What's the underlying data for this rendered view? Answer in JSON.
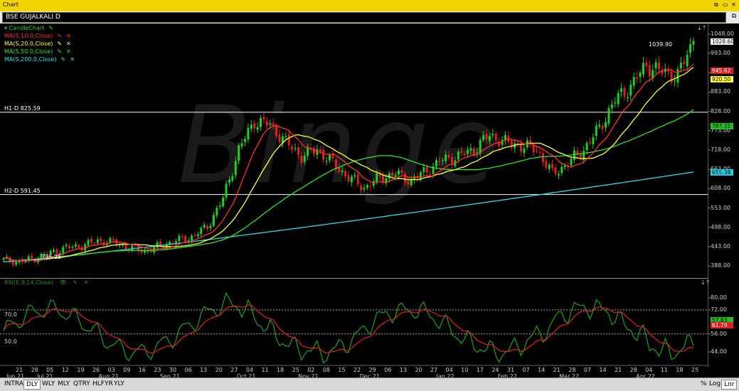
{
  "window": {
    "title": "Chart"
  },
  "symbol": {
    "text": "BSE GUJALKALI D"
  },
  "watermark": "Binge",
  "legend": [
    {
      "label": "CandleChart",
      "color": "#2ecc2e",
      "icons": [
        "triangle-icon",
        "pencil-icon"
      ]
    },
    {
      "label": "MA(S,10.0,Close)",
      "color": "#ff3030"
    },
    {
      "label": "MA(S,20.0,Close)",
      "color": "#ffff40"
    },
    {
      "label": "MA(S,50.0,Close)",
      "color": "#30e030"
    },
    {
      "label": "MA(S,200.0,Close)",
      "color": "#30e0e0"
    }
  ],
  "rsi_legend": {
    "label": "RSI(E,9,14,Close)",
    "color": "#2a8a2a"
  },
  "hlines": [
    {
      "label": "H1-D 825.59",
      "value": 825.59
    },
    {
      "label": "H2-D 591.45",
      "value": 591.45
    }
  ],
  "annotations": {
    "high": "1039.90",
    "low": "396.25"
  },
  "price_axis": [
    "1048.00",
    "993.00",
    "938.00",
    "883.00",
    "828.00",
    "773.00",
    "718.00",
    "663.00",
    "608.00",
    "553.00",
    "498.00",
    "443.00",
    "388.00"
  ],
  "price_tags": [
    {
      "text": "1028.60",
      "bg": "#ffffff",
      "fg": "#000000",
      "value": 1028.6
    },
    {
      "text": "945.62",
      "bg": "#e02020",
      "fg": "#ffffff",
      "value": 945.62
    },
    {
      "text": "920.50",
      "bg": "#ffff30",
      "fg": "#000000",
      "value": 920.5
    },
    {
      "text": "787.31",
      "bg": "#20c020",
      "fg": "#000000",
      "value": 787.31
    },
    {
      "text": "655.38",
      "bg": "#20d0e0",
      "fg": "#000000",
      "value": 655.38
    }
  ],
  "rsi_axis": [
    "80.00",
    "72.00",
    "56.00",
    "44.00"
  ],
  "rsi_levels": {
    "upper": "70.0",
    "lower": "50.0"
  },
  "rsi_tags": [
    {
      "text": "57.83",
      "bg": "#20c020",
      "fg": "#000",
      "value": 65.5
    },
    {
      "text": "61.79",
      "bg": "#e02020",
      "fg": "#fff",
      "value": 61.8
    }
  ],
  "x_days": [
    "21",
    "28",
    "05",
    "12",
    "19",
    "26",
    "03",
    "09",
    "16",
    "23",
    "30",
    "06",
    "13",
    "20",
    "27",
    "04",
    "11",
    "18",
    "25",
    "02",
    "08",
    "15",
    "22",
    "29",
    "06",
    "13",
    "20",
    "27",
    "04",
    "10",
    "17",
    "24",
    "31",
    "07",
    "14",
    "21",
    "28",
    "07",
    "14",
    "21",
    "28",
    "04",
    "11",
    "18",
    "25"
  ],
  "x_months": [
    {
      "label": "Jun 21",
      "idx": 0
    },
    {
      "label": "Jul 21",
      "idx": 2
    },
    {
      "label": "Aug 21",
      "idx": 6
    },
    {
      "label": "Sep 21",
      "idx": 10
    },
    {
      "label": "Oct 21",
      "idx": 15
    },
    {
      "label": "Nov 21",
      "idx": 19
    },
    {
      "label": "Dec 21",
      "idx": 23
    },
    {
      "label": "Jan 22",
      "idx": 28
    },
    {
      "label": "Feb 22",
      "idx": 32
    },
    {
      "label": "Mar 22",
      "idx": 36
    },
    {
      "label": "Apr 22",
      "idx": 41
    }
  ],
  "bottom": {
    "tabs": [
      "INTRA",
      "DLY",
      "WLY",
      "MLY",
      "QTRY",
      "HLFYR",
      "YLY"
    ],
    "active_tab": "DLY",
    "right": [
      "%",
      "Log",
      "Lnr"
    ],
    "active_right": "Lnr"
  },
  "chart_data": {
    "type": "candlestick",
    "title": "BSE GUJALKALI D",
    "price_range": [
      360,
      1060
    ],
    "weekly_closes": [
      405,
      400,
      410,
      425,
      440,
      445,
      460,
      455,
      440,
      430,
      445,
      460,
      470,
      500,
      580,
      720,
      800,
      790,
      740,
      700,
      720,
      680,
      640,
      610,
      640,
      650,
      630,
      660,
      690,
      700,
      720,
      760,
      740,
      730,
      720,
      650,
      680,
      720,
      780,
      860,
      900,
      960,
      940,
      930,
      1028.6
    ],
    "ma10_end": 945.62,
    "ma20_end": 920.5,
    "ma50_end": 787.31,
    "ma200_end": 655.38,
    "rsi_range": [
      36,
      88
    ],
    "rsi_end": 65.5,
    "rsi_ema_end": 61.79
  }
}
